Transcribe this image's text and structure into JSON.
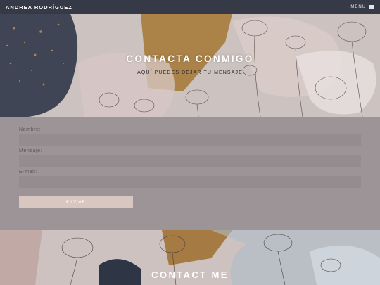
{
  "navbar": {
    "brand": "ANDREA RODRÍGUEZ",
    "menu_label": "MENU",
    "menu_icon": "hamburger-icon"
  },
  "hero": {
    "title": "CONTACTA CONMIGO",
    "subtitle": "AQUÍ PUEDES DEJAR TU MENSAJE"
  },
  "form": {
    "name_label": "Nombre:",
    "message_label": "Mensaje:",
    "email_label": "E-mail:",
    "name_value": "",
    "message_value": "",
    "email_value": "",
    "submit_label": "ENVIAR"
  },
  "footer": {
    "title": "CONTACT ME"
  },
  "colors": {
    "navbar": "#363a47",
    "form_background": "#9c9497",
    "input_background": "#948c8f",
    "button_background": "#d8c6c0",
    "accent_gold": "#b07a2a",
    "accent_navy": "#2e3545"
  }
}
